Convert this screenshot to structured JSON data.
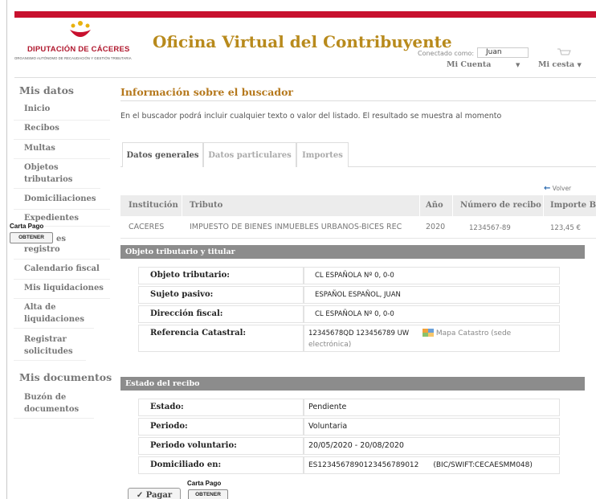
{
  "logo": {
    "title": "DIPUTACIÓN DE CÁCERES",
    "subtitle": "ORGANISMO AUTÓNOMO DE RECAUDACIÓN Y GESTIÓN TRIBUTARIA"
  },
  "header": {
    "app_title": "Oficina Virtual del Contribuyente",
    "connected_label": "Conectado como:",
    "user_name": "Juan",
    "account_menu": "Mi Cuenta",
    "cart_menu": "Mi cesta"
  },
  "colors": {
    "brand_red": "#c8102e",
    "title_gold": "#b88a1c",
    "heading_orange": "#b5781c",
    "section_gray": "#8c8c8c"
  },
  "sidebar": {
    "heading": "Mis datos",
    "items": [
      {
        "label": "Inicio"
      },
      {
        "label": "Recibos"
      },
      {
        "label": "Multas"
      },
      {
        "label": "Objetos tributarios"
      },
      {
        "label": "Domiciliaciones"
      },
      {
        "label": "Expedientes"
      },
      {
        "label": "Registros de registro"
      },
      {
        "label": "Calendario fiscal"
      },
      {
        "label": "Mis liquidaciones"
      },
      {
        "label": "Alta de liquidaciones"
      },
      {
        "label": "Registrar solicitudes"
      }
    ],
    "heading2": "Mis documentos",
    "items2": [
      {
        "label": "Buzón de documentos"
      }
    ],
    "visible_fragment": "es",
    "visible_registro": "registro"
  },
  "carta_pago": {
    "label": "Carta Pago",
    "button": "OBTENER"
  },
  "main": {
    "heading": "Información sobre el buscador",
    "intro": "En el buscador podrá incluir cualquier texto o valor del listado. El resultado se muestra al momento",
    "tabs": [
      {
        "label": "Datos generales",
        "active": true
      },
      {
        "label": "Datos particulares",
        "active": false
      },
      {
        "label": "Importes",
        "active": false
      }
    ],
    "back_link": "Volver",
    "receipt_table": {
      "headers": [
        "Institución",
        "Tributo",
        "Año",
        "Número de recibo",
        "Importe Ba"
      ],
      "row": [
        "CACERES",
        "IMPUESTO DE BIENES INMUEBLES URBANOS-BICES REC",
        "2020",
        "1234567-89",
        "123,45  €"
      ]
    },
    "section_owner": {
      "title": "Objeto tributario y titular",
      "rows": [
        {
          "label": "Objeto tributario:",
          "value": "CL ESPAÑOLA Nº 0, 0-0"
        },
        {
          "label": "Sujeto pasivo:",
          "value": "ESPAÑOL ESPAÑOL, JUAN"
        },
        {
          "label": "Dirección fiscal:",
          "value": "CL ESPAÑOLA Nº 0, 0-0"
        },
        {
          "label": "Referencia Catastral:",
          "value": "12345678QD 123456789  UW",
          "link": "Mapa Catastro (sede",
          "link2": "electrónica)"
        }
      ]
    },
    "section_status": {
      "title": "Estado del recibo",
      "rows": [
        {
          "label": "Estado:",
          "value": "Pendiente"
        },
        {
          "label": "Periodo:",
          "value": "Voluntaria"
        },
        {
          "label": "Periodo voluntario:",
          "value": "20/05/2020 - 20/08/2020"
        },
        {
          "label": "Domiciliado en:",
          "value": "ES1234567890123456789012",
          "bic": "(BIC/SWIFT:CECAESMM048)"
        }
      ]
    },
    "pay_button": "Pagar"
  }
}
